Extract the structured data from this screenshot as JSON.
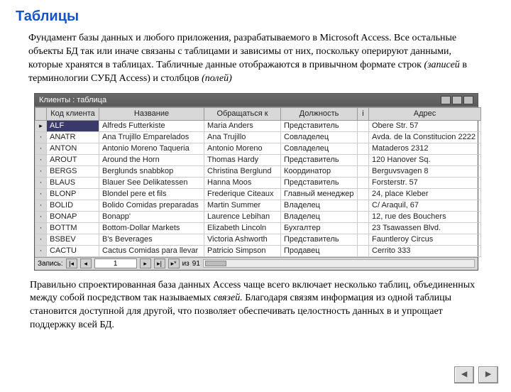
{
  "heading": "Таблицы",
  "lead_html": "Фундамент базы данных и любого приложения, разрабатываемого в Microsoft Access. Все остальные объекты БД так или иначе связаны с таблицами и зависимы от них, поскольку оперируют данными, которые хранятся в таблицах. Табличные данные отображаются в привычном формате строк ",
  "lead_italic1": "(записей",
  "lead_mid": " в терминологии СУБД Access) и столбцов ",
  "lead_italic2": "(полей)",
  "window_title": "Клиенты : таблица",
  "columns": [
    "Код клиента",
    "Название",
    "Обращаться к",
    "Должность",
    "і",
    "Адрес"
  ],
  "rows": [
    {
      "sel": "arrow",
      "hl": true,
      "cells": [
        "ALF",
        "Alfreds Futterkiste",
        "Maria Anders",
        "Представитель",
        "",
        "Obere Str. 57"
      ]
    },
    {
      "sel": "dot",
      "cells": [
        "ANATR",
        "Ana Trujillo Emparelados",
        "Ana Trujillo",
        "Совладелец",
        "",
        "Avda. de la Constitucion 2222"
      ]
    },
    {
      "sel": "dot",
      "cells": [
        "ANTON",
        "Antonio Moreno Taqueria",
        "Antonio Moreno",
        "Совладелец",
        "",
        "Mataderos 2312"
      ]
    },
    {
      "sel": "dot",
      "cells": [
        "AROUT",
        "Around the Horn",
        "Thomas Hardy",
        "Представитель",
        "",
        "120 Hanover Sq."
      ]
    },
    {
      "sel": "dot",
      "cells": [
        "BERGS",
        "Berglunds snabbkop",
        "Christina Berglund",
        "Координатор",
        "",
        "Berguvsvagen 8"
      ]
    },
    {
      "sel": "dot",
      "cells": [
        "BLAUS",
        "Blauer See Delikatessen",
        "Hanna Moos",
        "Представитель",
        "",
        "Forsterstr. 57"
      ]
    },
    {
      "sel": "dot",
      "cells": [
        "BLONP",
        "Blondel pere et fils",
        "Frederique Citeaux",
        "Главный менеджер",
        "",
        "24, place Kleber"
      ]
    },
    {
      "sel": "dot",
      "cells": [
        "BOLID",
        "Bolido Comidas preparadas",
        "Martin Summer",
        "Владелец",
        "",
        "C/ Araquil, 67"
      ]
    },
    {
      "sel": "dot",
      "cells": [
        "BONAP",
        "Bonapp'",
        "Laurence Lebihan",
        "Владелец",
        "",
        "12, rue des Bouchers"
      ]
    },
    {
      "sel": "dot",
      "cells": [
        "BOTTM",
        "Bottom-Dollar Markets",
        "Elizabeth Lincoln",
        "Бухгалтер",
        "",
        "23 Tsawassen Blvd."
      ]
    },
    {
      "sel": "dot",
      "cells": [
        "BSBEV",
        "B's Beverages",
        "Victoria Ashworth",
        "Представитель",
        "",
        "Fauntleroy Circus"
      ]
    },
    {
      "sel": "dot",
      "cells": [
        "CACTU",
        "Cactus Comidas para llevar",
        "Patricio Simpson",
        "Продавец",
        "",
        "Cerrito 333"
      ]
    }
  ],
  "nav": {
    "label": "Запись:",
    "first": "|◂",
    "prev": "◂",
    "current": "1",
    "next": "▸",
    "last": "▸|",
    "new": "▸*",
    "total_prefix": "из",
    "total": "91"
  },
  "closing_text": "Правильно спроектированная база данных Access чаще всего включает несколько таблиц, объединенных между собой посредством так называемых ",
  "closing_italic": "связей.",
  "closing_tail": " Благодаря связям информация из одной таблицы становится доступной для другой, что позволяет обеспечивать целостность данных в и упрощает поддержку всей БД.",
  "footer": {
    "prev": "◄",
    "next": "►"
  }
}
